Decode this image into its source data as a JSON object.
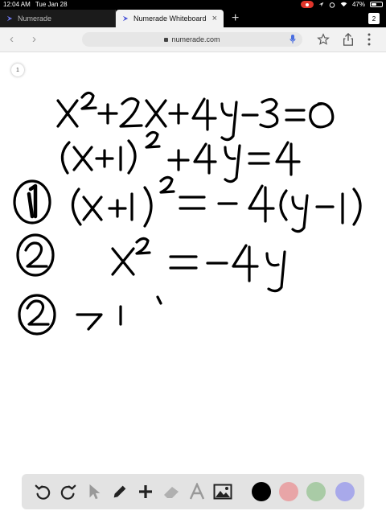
{
  "status": {
    "time": "12:04 AM",
    "date": "Tue Jan 28",
    "battery": "47%",
    "battery_level": 0.47
  },
  "tabs": [
    {
      "title": "Numerade",
      "active": false
    },
    {
      "title": "Numerade Whiteboard",
      "active": true
    }
  ],
  "tab_count": "2",
  "url": "numerade.com",
  "canvas": {
    "page_number": "1",
    "math_lines": [
      "x² + 2x + 4y − 3 = 0",
      "(x + 1)² + 4y = 4",
      "(x + 1)² = − 4(y − 1)",
      "x² = −4y",
      "→ 1"
    ],
    "circled_numbers": [
      "1",
      "2",
      "2"
    ]
  },
  "colors": {
    "ink": "#000000",
    "swatch_black": "#000000",
    "swatch_pink": "#e8a5a7",
    "swatch_green": "#a9cba6",
    "swatch_purple": "#a8a9ea"
  },
  "whiteboard_tools": [
    "undo-icon",
    "redo-icon",
    "pointer-icon",
    "pen-icon",
    "add-icon",
    "eraser-icon",
    "text-icon",
    "image-icon"
  ]
}
